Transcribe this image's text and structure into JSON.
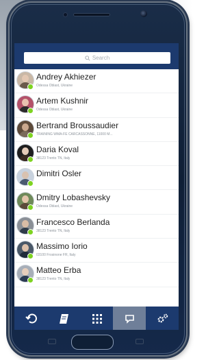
{
  "search": {
    "placeholder": "Search"
  },
  "contacts": [
    {
      "name": "Andrey Akhiezer",
      "location": "Odessa Oblast, Ukraine"
    },
    {
      "name": "Artem Kushnir",
      "location": "Odessa Oblast, Ukraine"
    },
    {
      "name": "Bertrand Broussaudier",
      "location": "TRAINING WMA-FE CARCASSONNE, 11000 M..."
    },
    {
      "name": "Daria Koval",
      "location": "38123 Trento TN, Italy"
    },
    {
      "name": "Dimitri Osler",
      "location": ""
    },
    {
      "name": "Dmitry Lobashevsky",
      "location": "Odessa Oblast, Ukraine"
    },
    {
      "name": "Francesco Berlanda",
      "location": "38123 Trento TN, Italy"
    },
    {
      "name": "Massimo Iorio",
      "location": "03100 Frosinone FR, Italy"
    },
    {
      "name": "Matteo Erba",
      "location": "38123 Trento TN, Italy"
    }
  ],
  "nav": [
    {
      "icon": "history-icon",
      "active": false
    },
    {
      "icon": "notebook-icon",
      "active": false
    },
    {
      "icon": "grid-icon",
      "active": false
    },
    {
      "icon": "chat-icon",
      "active": true
    },
    {
      "icon": "settings-icon",
      "active": false
    }
  ],
  "colors": {
    "bar": "#1c3a6e",
    "active_tab": "#6f7f99",
    "online": "#7ed321"
  }
}
